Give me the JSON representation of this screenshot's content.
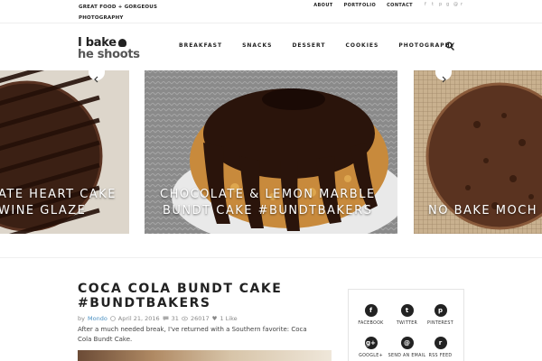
{
  "topbar": {
    "tagline": "GREAT FOOD + GORGEOUS PHOTOGRAPHY",
    "links": [
      "ABOUT",
      "PORTFOLIO",
      "CONTACT"
    ],
    "social_icons": [
      "facebook-icon",
      "twitter-icon",
      "pinterest-icon",
      "googleplus-icon",
      "email-icon",
      "rss-icon"
    ]
  },
  "logo": {
    "line1": "I bake",
    "line2": "he shoots"
  },
  "nav": {
    "items": [
      "BREAKFAST",
      "SNACKS",
      "DESSERT",
      "COOKIES",
      "PHOTOGRAPHY"
    ]
  },
  "slider": {
    "left_caption_1": "ATE HEART CAKE",
    "left_caption_2": "WINE GLAZE",
    "center_caption_1": "CHOCOLATE & LEMON MARBLE",
    "center_caption_2": "BUNDT CAKE #BUNDTBAKERS",
    "right_caption": "NO BAKE MOCH"
  },
  "article": {
    "title": "COCA COLA BUNDT CAKE #BUNDTBAKERS",
    "by_label": "by",
    "author": "Mondo",
    "date": "April 21, 2016",
    "comments": "31",
    "views": "26017",
    "likes": "1 Like",
    "excerpt": "After a much needed break, I've returned with a Southern favorite: Coca Cola Bundt Cake."
  },
  "share": {
    "items": [
      {
        "label": "FACEBOOK",
        "glyph": "f"
      },
      {
        "label": "TWITTER",
        "glyph": "t"
      },
      {
        "label": "PINTEREST",
        "glyph": "p"
      },
      {
        "label": "GOOGLE+",
        "glyph": "g+"
      },
      {
        "label": "SEND AN EMAIL",
        "glyph": "@"
      },
      {
        "label": "RSS FEED",
        "glyph": "r"
      }
    ]
  },
  "colors": {
    "author_link": "#4a90c2",
    "text_dark": "#222222",
    "icon_circle": "#222222"
  }
}
